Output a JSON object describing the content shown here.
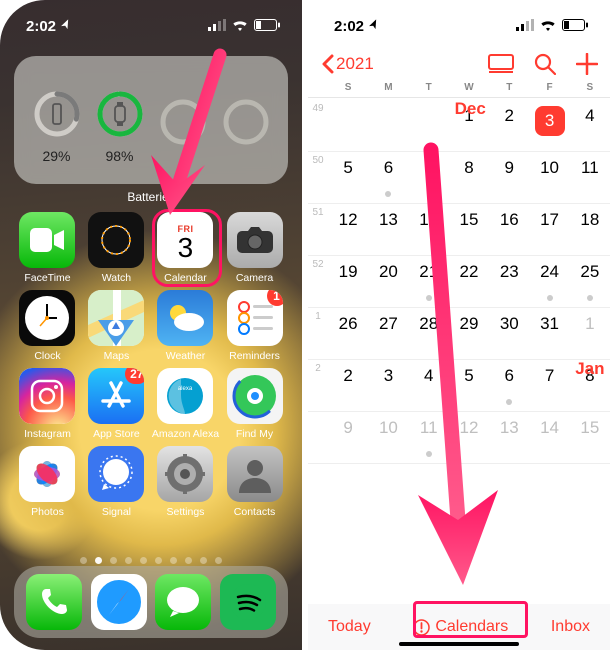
{
  "status": {
    "time": "2:02",
    "location_arrow": "➤",
    "signal": "bars-3",
    "wifi": "wifi",
    "battery": "low"
  },
  "widget": {
    "label": "Batteries",
    "devices": [
      {
        "icon": "phone",
        "pct": "29%",
        "stroke": "#7a7a7a",
        "fill": 0.29
      },
      {
        "icon": "watch",
        "pct": "98%",
        "stroke": "#19b63f",
        "fill": 0.98
      },
      {
        "icon": "",
        "pct": "",
        "stroke": "#b5b5b2",
        "fill": 0
      },
      {
        "icon": "",
        "pct": "",
        "stroke": "#b5b5b2",
        "fill": 0
      }
    ]
  },
  "apps": [
    {
      "id": "facetime",
      "label": "FaceTime"
    },
    {
      "id": "watch",
      "label": "Watch"
    },
    {
      "id": "calendar",
      "label": "Calendar",
      "dow": "FRI",
      "day": "3"
    },
    {
      "id": "camera",
      "label": "Camera"
    },
    {
      "id": "clock",
      "label": "Clock"
    },
    {
      "id": "maps",
      "label": "Maps"
    },
    {
      "id": "weather",
      "label": "Weather"
    },
    {
      "id": "reminders",
      "label": "Reminders",
      "badge": "1"
    },
    {
      "id": "instagram",
      "label": "Instagram"
    },
    {
      "id": "appstore",
      "label": "App Store",
      "badge": "27"
    },
    {
      "id": "alexa",
      "label": "Amazon Alexa"
    },
    {
      "id": "findmy",
      "label": "Find My"
    },
    {
      "id": "photos",
      "label": "Photos"
    },
    {
      "id": "signal",
      "label": "Signal"
    },
    {
      "id": "settings",
      "label": "Settings"
    },
    {
      "id": "contacts",
      "label": "Contacts"
    }
  ],
  "dock": [
    "phone",
    "safari",
    "messages",
    "spotify"
  ],
  "page_dots": {
    "count": 10,
    "active": 1
  },
  "calendar": {
    "back_label": "2021",
    "dow": [
      "S",
      "M",
      "T",
      "W",
      "T",
      "F",
      "S"
    ],
    "months": [
      {
        "label": "Dec",
        "col": 3,
        "wk": 0
      },
      {
        "label": "Jan",
        "col": 6,
        "wk": 5
      }
    ],
    "weeks": [
      {
        "no": "49",
        "days": [
          null,
          null,
          null,
          "1",
          "2",
          "3",
          "4"
        ],
        "today_idx": 5,
        "dots": []
      },
      {
        "no": "50",
        "days": [
          "5",
          "6",
          "7",
          "8",
          "9",
          "10",
          "11"
        ],
        "dots": [
          1
        ]
      },
      {
        "no": "51",
        "days": [
          "12",
          "13",
          "14",
          "15",
          "16",
          "17",
          "18"
        ],
        "dots": []
      },
      {
        "no": "52",
        "days": [
          "19",
          "20",
          "21",
          "22",
          "23",
          "24",
          "25"
        ],
        "dots": [
          2,
          5,
          6
        ]
      },
      {
        "no": "1",
        "days": [
          "26",
          "27",
          "28",
          "29",
          "30",
          "31",
          "1"
        ],
        "dots": [],
        "month_break": 6
      },
      {
        "no": "2",
        "days": [
          "2",
          "3",
          "4",
          "5",
          "6",
          "7",
          "8"
        ],
        "dots": [
          4
        ]
      },
      {
        "no": "",
        "days": [
          "9",
          "10",
          "11",
          "12",
          "13",
          "14",
          "15"
        ],
        "dots": [
          2
        ]
      }
    ],
    "toolbar": {
      "today": "Today",
      "calendars": "Calendars",
      "inbox": "Inbox"
    }
  },
  "annotations": {
    "highlight1": {
      "target": "calendar-app"
    },
    "highlight2": {
      "target": "calendars-button"
    }
  }
}
